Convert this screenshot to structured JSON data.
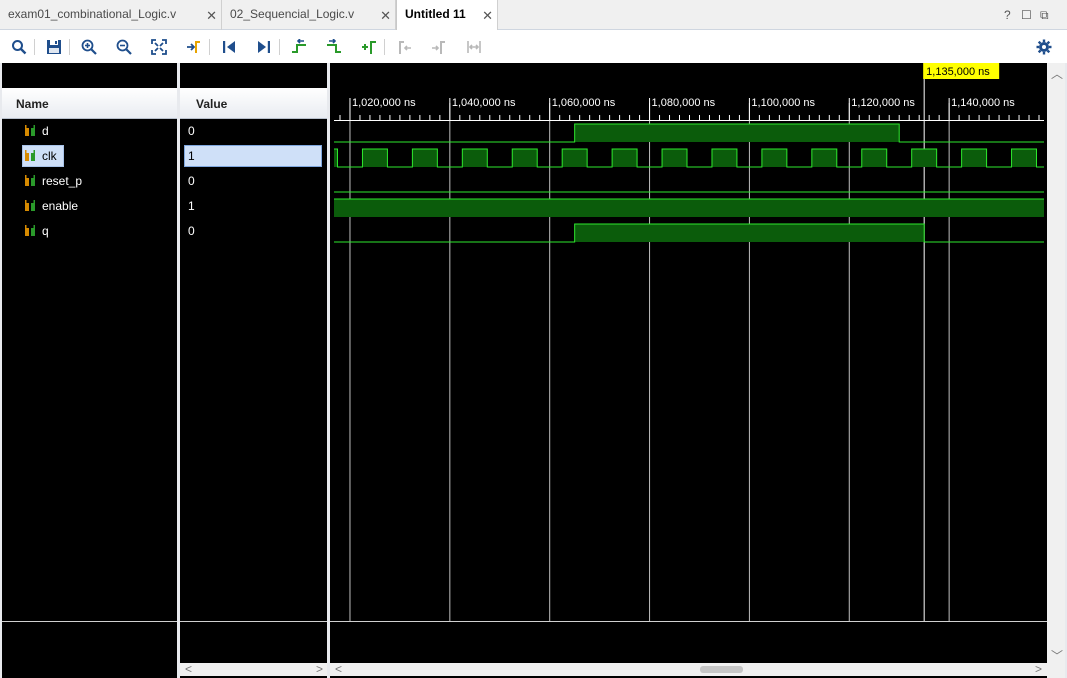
{
  "tabs": [
    {
      "label": "exam01_combinational_Logic.v",
      "active": false
    },
    {
      "label": "02_Sequencial_Logic.v",
      "active": false
    },
    {
      "label": "Untitled 11",
      "active": true
    }
  ],
  "window_controls": {
    "help": "?",
    "restore": "☐",
    "float": "⧉"
  },
  "toolbar_icons": [
    "search-icon",
    "save-icon",
    "zoom-in-icon",
    "zoom-out-icon",
    "zoom-fit-icon",
    "go-to-cursor-icon",
    "go-to-time-zero-icon",
    "go-to-last-time-icon",
    "previous-transition-icon",
    "next-transition-icon",
    "add-marker-icon",
    "previous-marker-icon",
    "next-marker-icon",
    "swap-cursors-icon",
    "settings-icon"
  ],
  "columns": {
    "name": "Name",
    "value": "Value"
  },
  "signals": [
    {
      "name": "d",
      "value": "0",
      "selected": false
    },
    {
      "name": "clk",
      "value": "1",
      "selected": true
    },
    {
      "name": "reset_p",
      "value": "0",
      "selected": false
    },
    {
      "name": "enable",
      "value": "1",
      "selected": false
    },
    {
      "name": "q",
      "value": "0",
      "selected": false
    }
  ],
  "timeline": {
    "unit": "ns",
    "labels": [
      "1,020,000 ns",
      "1,040,000 ns",
      "1,060,000 ns",
      "1,080,000 ns",
      "1,100,000 ns",
      "1,120,000 ns",
      "1,140,000 ns"
    ],
    "label_times": [
      1020000,
      1040000,
      1060000,
      1080000,
      1100000,
      1120000,
      1140000
    ],
    "view_start": 1016800,
    "view_end": 1159000,
    "cursor_time": 1135000,
    "cursor_label": "1,135,000 ns",
    "clock_period": 10000
  },
  "waveforms": {
    "d": {
      "type": "bit",
      "transitions": [
        [
          1016800,
          0
        ],
        [
          1065000,
          1
        ],
        [
          1130000,
          0
        ]
      ]
    },
    "clk": {
      "type": "clock",
      "first_edge": 1017500,
      "period": 10000,
      "start_level": 1
    },
    "reset_p": {
      "type": "bit",
      "transitions": [
        [
          1016800,
          0
        ]
      ]
    },
    "enable": {
      "type": "bit",
      "transitions": [
        [
          1016800,
          1
        ]
      ]
    },
    "q": {
      "type": "bit",
      "transitions": [
        [
          1016800,
          0
        ],
        [
          1065000,
          1
        ],
        [
          1135000,
          0
        ]
      ]
    }
  },
  "colors": {
    "wave_line": "#2ee82e",
    "wave_fill": "#0b5c0b",
    "cursor_label_bg": "#ffff00",
    "selection": "#cfe0f8",
    "grid": "#bfbfbf"
  }
}
